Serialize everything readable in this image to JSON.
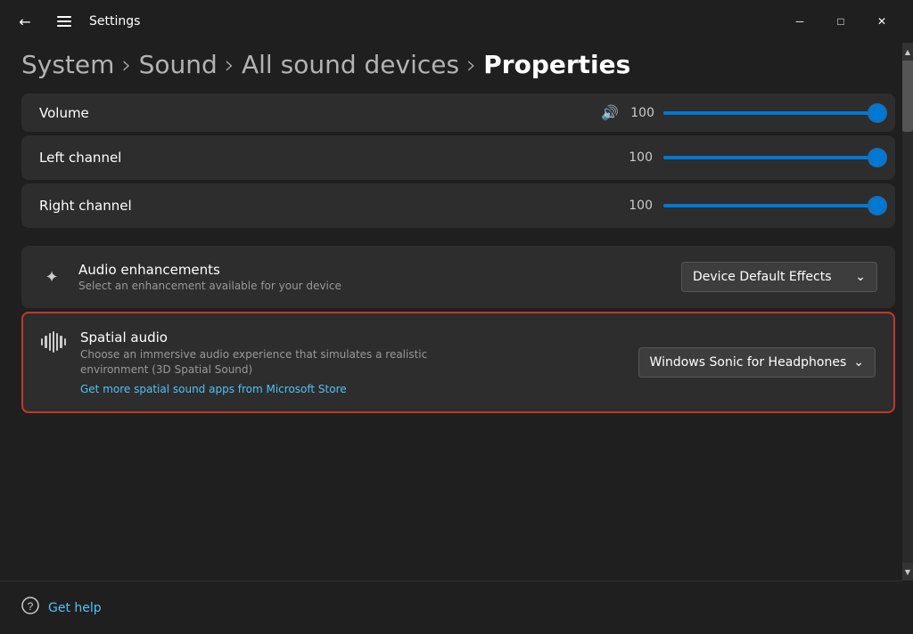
{
  "titlebar": {
    "title": "Settings",
    "minimize_label": "─",
    "maximize_label": "□",
    "close_label": "✕"
  },
  "breadcrumb": {
    "items": [
      {
        "label": "System",
        "active": false
      },
      {
        "label": "Sound",
        "active": false
      },
      {
        "label": "All sound devices",
        "active": false
      },
      {
        "label": "Properties",
        "active": true
      }
    ],
    "separator": "›"
  },
  "volume": {
    "label": "Volume",
    "value": "100",
    "icon": "🔊"
  },
  "left_channel": {
    "label": "Left channel",
    "value": "100"
  },
  "right_channel": {
    "label": "Right channel",
    "value": "100"
  },
  "audio_enhancements": {
    "icon": "✦",
    "title": "Audio enhancements",
    "description": "Select an enhancement available for your device",
    "dropdown": {
      "label": "Device Default Effects",
      "arrow": "⌄"
    }
  },
  "spatial_audio": {
    "title": "Spatial audio",
    "description": "Choose an immersive audio experience that simulates a realistic environment (3D Spatial Sound)",
    "link": "Get more spatial sound apps from Microsoft Store",
    "dropdown": {
      "label": "Windows Sonic for Headphones",
      "arrow": "⌄"
    }
  },
  "footer": {
    "icon": "❓",
    "link_label": "Get help"
  },
  "colors": {
    "accent": "#0078d4",
    "border_highlight": "#c0392b",
    "link": "#4fc3f7"
  }
}
